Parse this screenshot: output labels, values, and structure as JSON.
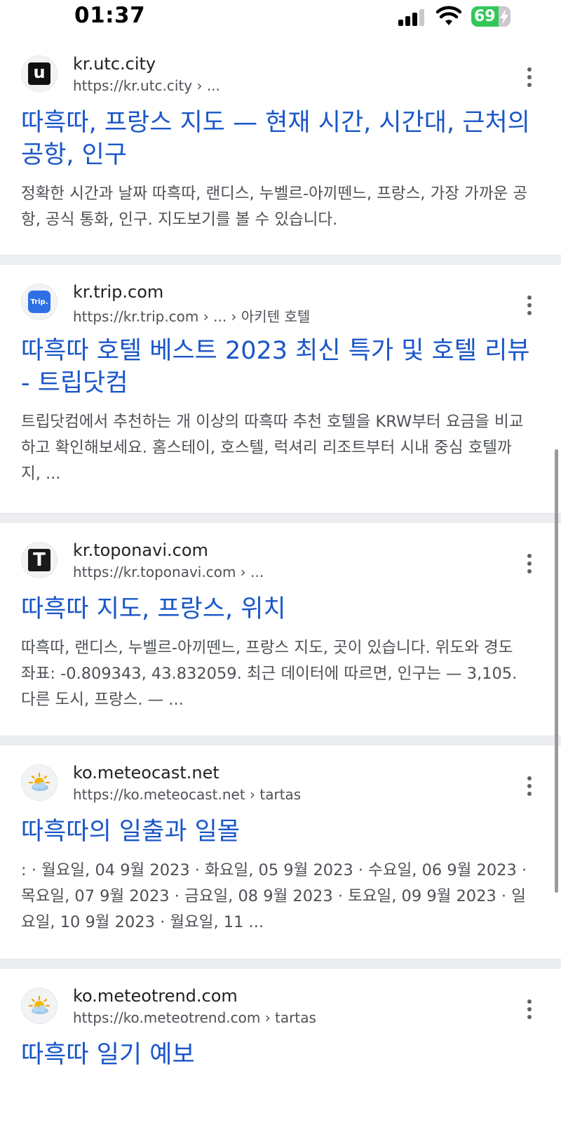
{
  "status_bar": {
    "time": "01:37",
    "battery": "69",
    "battery_level": 0.69
  },
  "results": [
    {
      "site_name": "kr.utc.city",
      "url": "https://kr.utc.city › ...",
      "favicon": "u-logo-icon",
      "favicon_text": "u",
      "title": "따흑따, 프랑스 지도 — 현재 시간, 시간대, 근처의 공항, 인구",
      "snippet": "정확한 시간과 날짜 따흑따, 랜디스, 누벨르-아끼뗀느, 프랑스, 가장 가까운 공항, 공식 통화, 인구. 지도보기를 볼 수 있습니다."
    },
    {
      "site_name": "kr.trip.com",
      "url": "https://kr.trip.com › ... › 아키텐 호텔",
      "favicon": "trip-logo-icon",
      "favicon_text": "Trip.",
      "title": "따흑따 호텔 베스트 2023 최신 특가 및 호텔 리뷰 - 트립닷컴",
      "snippet": "트립닷컴에서 추천하는 개 이상의 따흑따 추천 호텔을 KRW부터 요금을 비교하고 확인해보세요. 홈스테이, 호스텔, 럭셔리 리조트부터 시내 중심 호텔까지, ..."
    },
    {
      "site_name": "kr.toponavi.com",
      "url": "https://kr.toponavi.com › ...",
      "favicon": "t-logo-icon",
      "favicon_text": "T",
      "title": "따흑따 지도, 프랑스, 위치",
      "snippet": "따흑따, 랜디스, 누벨르-아끼뗀느, 프랑스 지도, 곳이 있습니다. 위도와 경도 좌표: -0.809343, 43.832059. 최근 데이터에 따르면, 인구는 — 3,105. 다른 도시, 프랑스. — ..."
    },
    {
      "site_name": "ko.meteocast.net",
      "url": "https://ko.meteocast.net › tartas",
      "favicon": "sun-cloud-icon",
      "favicon_text": "",
      "title": "따흑따의 일출과 일몰",
      "snippet": ": · 월요일, 04 9월 2023 · 화요일, 05 9월 2023 · 수요일, 06 9월 2023 · 목요일, 07 9월 2023 · 금요일, 08 9월 2023 · 토요일, 09 9월 2023 · 일요일, 10 9월 2023 · 월요일, 11 ..."
    },
    {
      "site_name": "ko.meteotrend.com",
      "url": "https://ko.meteotrend.com › tartas",
      "favicon": "sun-cloud-icon",
      "favicon_text": "",
      "title": "따흑따 일기 예보",
      "snippet": ""
    }
  ],
  "colors": {
    "link": "#1a56c8",
    "divider": "#eceef1",
    "snippet": "#4d5156",
    "battery": "#34c759"
  }
}
